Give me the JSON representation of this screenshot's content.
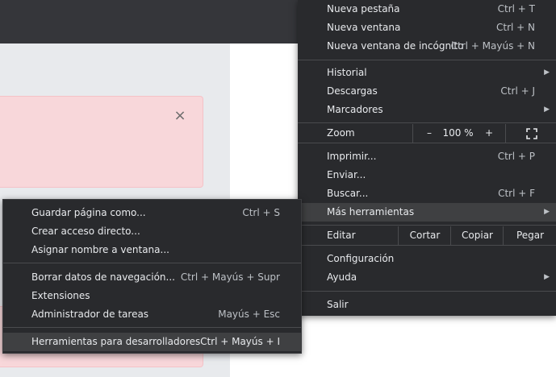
{
  "main_menu": {
    "items": [
      {
        "label": "Nueva pestaña",
        "shortcut": "Ctrl + T"
      },
      {
        "label": "Nueva ventana",
        "shortcut": "Ctrl + N"
      },
      {
        "label": "Nueva ventana de incógnito",
        "shortcut": "Ctrl + Mayús + N"
      },
      {
        "label": "Historial",
        "shortcut": ""
      },
      {
        "label": "Descargas",
        "shortcut": "Ctrl + J"
      },
      {
        "label": "Marcadores",
        "shortcut": ""
      },
      {
        "label": "Imprimir...",
        "shortcut": "Ctrl + P"
      },
      {
        "label": "Enviar...",
        "shortcut": ""
      },
      {
        "label": "Buscar...",
        "shortcut": "Ctrl + F"
      },
      {
        "label": "Más herramientas",
        "shortcut": ""
      },
      {
        "label": "Configuración",
        "shortcut": ""
      },
      {
        "label": "Ayuda",
        "shortcut": ""
      },
      {
        "label": "Salir",
        "shortcut": ""
      }
    ],
    "zoom": {
      "label": "Zoom",
      "minus": "–",
      "value": "100 %",
      "plus": "+"
    },
    "edit": {
      "label": "Editar",
      "cut": "Cortar",
      "copy": "Copiar",
      "paste": "Pegar"
    }
  },
  "sub_menu": {
    "items": [
      {
        "label": "Guardar página como...",
        "shortcut": "Ctrl + S"
      },
      {
        "label": "Crear acceso directo...",
        "shortcut": ""
      },
      {
        "label": "Asignar nombre a ventana...",
        "shortcut": ""
      },
      {
        "label": "Borrar datos de navegación...",
        "shortcut": "Ctrl + Mayús + Supr"
      },
      {
        "label": "Extensiones",
        "shortcut": ""
      },
      {
        "label": "Administrador de tareas",
        "shortcut": "Mayús + Esc"
      },
      {
        "label": "Herramientas para desarrolladores",
        "shortcut": "Ctrl + Mayús + I"
      }
    ]
  },
  "alert": {
    "close_symbol": "×"
  },
  "colors": {
    "menu_bg": "#292a2d",
    "highlight": "#3f4042",
    "alert_bg": "#f8d7da",
    "topbar": "#35363a"
  }
}
